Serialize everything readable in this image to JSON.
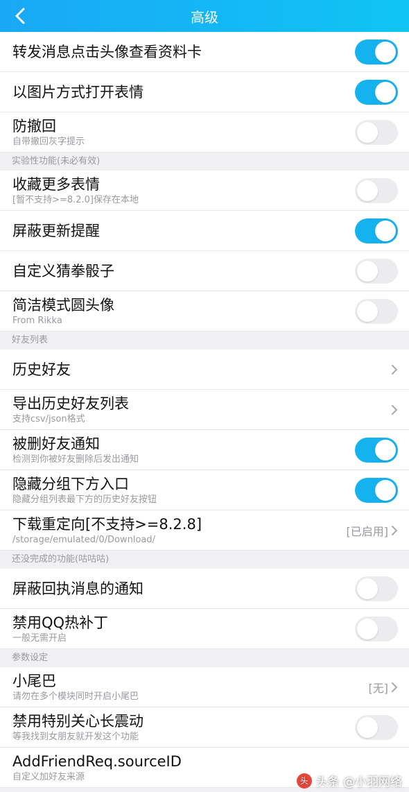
{
  "header": {
    "title": "高级"
  },
  "rows": [
    {
      "label": "转发消息点击头像查看资料卡",
      "sub": "",
      "toggle": "on"
    },
    {
      "label": "以图片方式打开表情",
      "sub": "",
      "toggle": "on"
    },
    {
      "label": "防撤回",
      "sub": "自带撤回灰字提示",
      "toggle": "off"
    }
  ],
  "section1": "实验性功能(未必有效)",
  "rows2": [
    {
      "label": "收藏更多表情",
      "sub": "[暂不支持>=8.2.0]保存在本地",
      "toggle": "off"
    },
    {
      "label": "屏蔽更新提醒",
      "sub": "",
      "toggle": "on"
    },
    {
      "label": "自定义猜拳骰子",
      "sub": "",
      "toggle": "off"
    },
    {
      "label": "简洁模式圆头像",
      "sub": "From Rikka",
      "toggle": "off"
    }
  ],
  "section2": "好友列表",
  "rows3": [
    {
      "label": "历史好友",
      "sub": ""
    },
    {
      "label": "导出历史好友列表",
      "sub": "支持csv/json格式"
    },
    {
      "label": "被删好友通知",
      "sub": "检测到你被好友删除后发出通知",
      "toggle": "on"
    },
    {
      "label": "隐藏分组下方入口",
      "sub": "隐藏分组列表最下方的历史好友按钮",
      "toggle": "on"
    },
    {
      "label": "下载重定向[不支持>=8.2.8]",
      "sub": "/storage/emulated/0/Download/",
      "value": "[已启用]"
    }
  ],
  "section3": "还没完成的功能(咕咕咕)",
  "rows4": [
    {
      "label": "屏蔽回执消息的通知",
      "sub": "",
      "toggle": "off"
    },
    {
      "label": "禁用QQ热补丁",
      "sub": "一般无需开启",
      "toggle": "off"
    }
  ],
  "section4": "参数设定",
  "rows5": [
    {
      "label": "小尾巴",
      "sub": "请勿在多个模块同时开启小尾巴",
      "value": "[无]"
    },
    {
      "label": "禁用特别关心长震动",
      "sub": "等我找到女朋友就开发这个功能",
      "toggle": "off"
    },
    {
      "label": "AddFriendReq.sourceID",
      "sub": "自定义加好友来源"
    }
  ],
  "watermark": {
    "text": "头条 @小羽网络"
  },
  "colors": {
    "accent": "#15b2f0",
    "header": "#19a8f5",
    "toggle_off": "#ececef"
  }
}
